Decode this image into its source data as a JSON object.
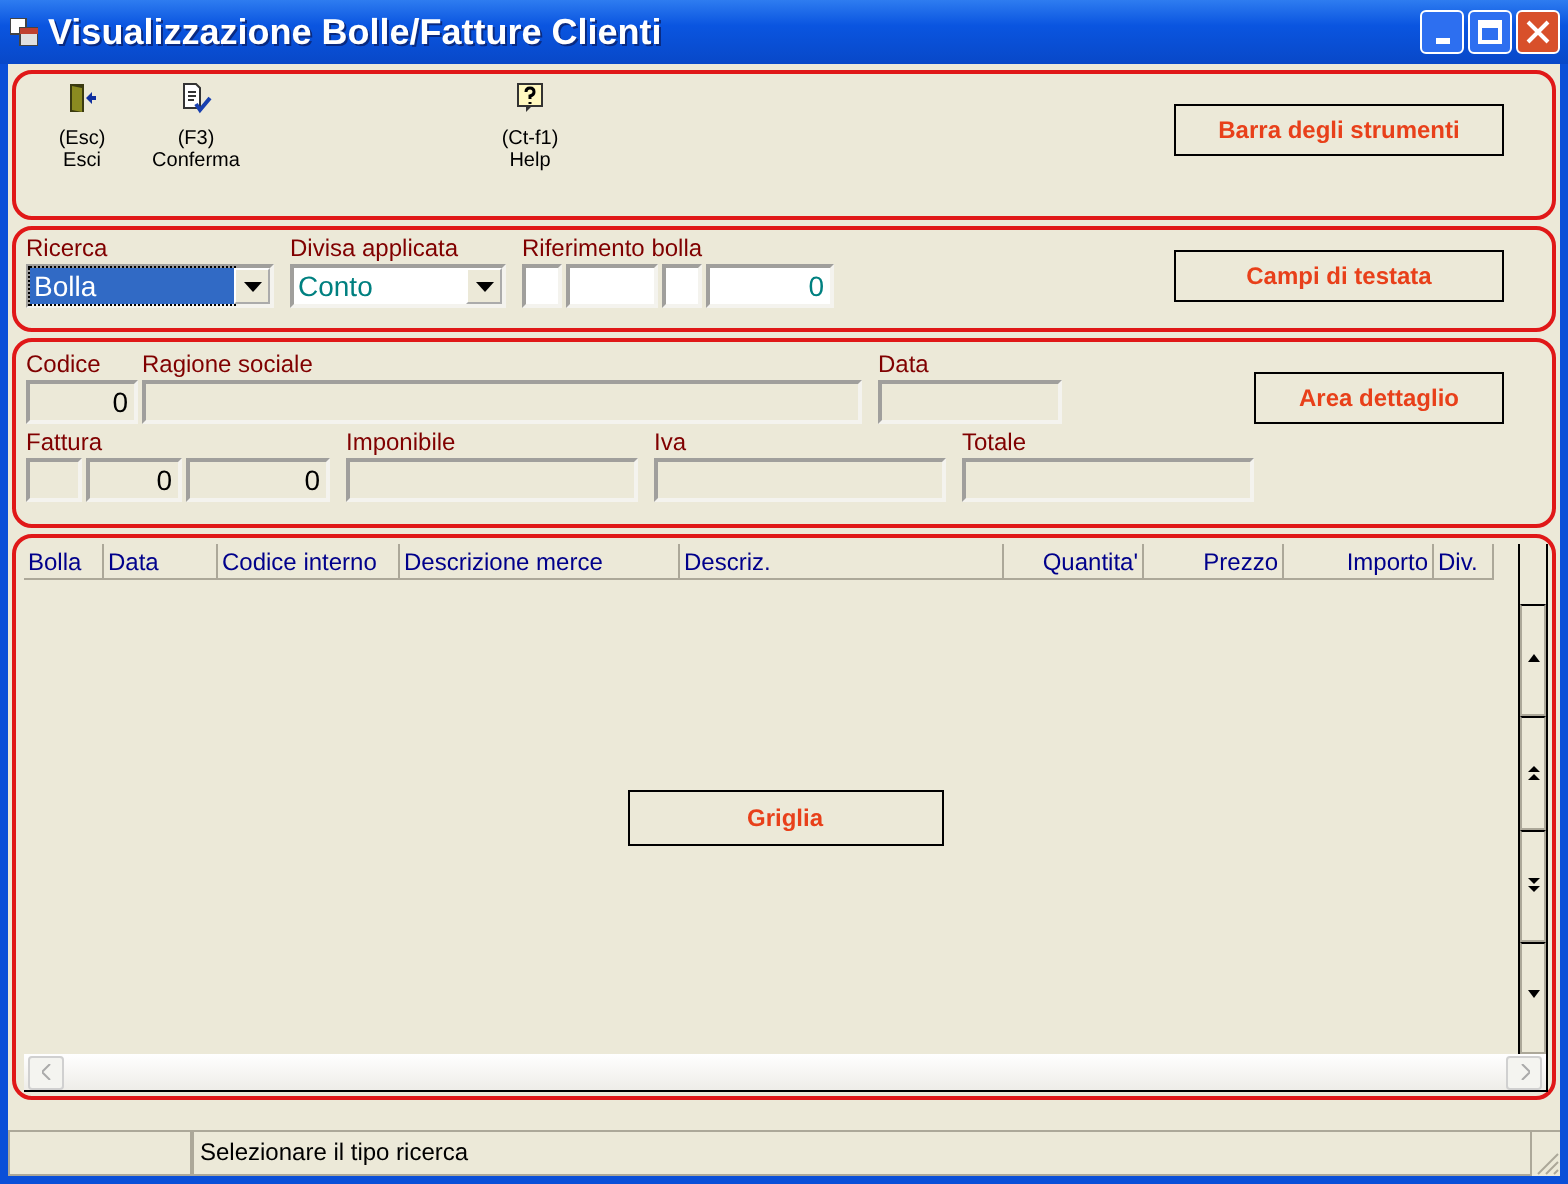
{
  "window": {
    "title": "Visualizzazione Bolle/Fatture Clienti"
  },
  "toolbar": {
    "buttons": [
      {
        "kind": "exit",
        "shortcut": "(Esc)",
        "label": "Esci"
      },
      {
        "kind": "confirm",
        "shortcut": "(F3)",
        "label": "Conferma"
      },
      {
        "kind": "help",
        "shortcut": "(Ct-f1)",
        "label": "Help"
      }
    ],
    "callout": "Barra degli strumenti"
  },
  "header": {
    "ricerca": {
      "label": "Ricerca",
      "value": "Bolla",
      "selected": true
    },
    "divisa": {
      "label": "Divisa applicata",
      "value": "Conto",
      "selected": false
    },
    "riferimento": {
      "label": "Riferimento bolla",
      "value": "0"
    },
    "callout": "Campi di testata"
  },
  "detail": {
    "codice": {
      "label": "Codice",
      "value": "0"
    },
    "ragione_sociale": {
      "label": "Ragione sociale"
    },
    "data": {
      "label": "Data"
    },
    "fattura": {
      "label": "Fattura",
      "values": [
        "0",
        "0"
      ]
    },
    "imponibile": {
      "label": "Imponibile"
    },
    "iva": {
      "label": "Iva"
    },
    "totale": {
      "label": "Totale"
    },
    "callout": "Area dettaglio"
  },
  "grid": {
    "columns": [
      {
        "label": "Bolla"
      },
      {
        "label": "Data"
      },
      {
        "label": "Codice interno"
      },
      {
        "label": "Descrizione merce"
      },
      {
        "label": "Descriz."
      },
      {
        "label": "Quantita'"
      },
      {
        "label": "Prezzo"
      },
      {
        "label": "Importo"
      },
      {
        "label": "Div."
      }
    ],
    "callout": "Griglia"
  },
  "status_bar": {
    "message": "Selezionare il tipo ricerca"
  }
}
